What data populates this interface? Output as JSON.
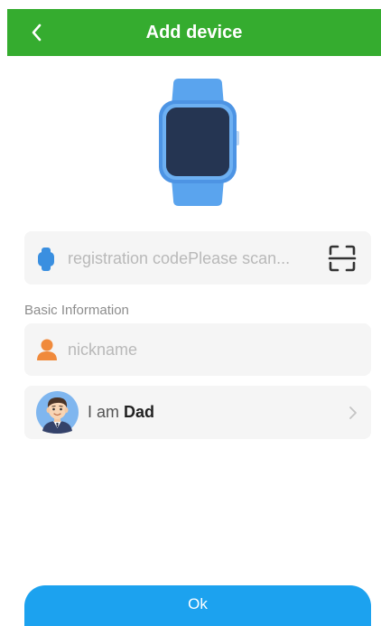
{
  "header": {
    "title": "Add device",
    "back_icon": "chevron-left-icon",
    "background_color": "#35ac2f"
  },
  "illustration": {
    "icon": "smartwatch-icon"
  },
  "registration": {
    "icon": "watch-icon",
    "placeholder": "registration codePlease scan...",
    "value": "",
    "scan_icon": "scan-icon"
  },
  "basic_info": {
    "section_label": "Basic Information",
    "nickname": {
      "icon": "person-icon",
      "placeholder": "nickname",
      "value": ""
    },
    "relation": {
      "avatar_icon": "dad-avatar-icon",
      "prefix": "I am ",
      "value": "Dad",
      "chevron_icon": "chevron-right-icon"
    }
  },
  "footer": {
    "ok_label": "Ok",
    "button_color": "#1ca2ef"
  }
}
